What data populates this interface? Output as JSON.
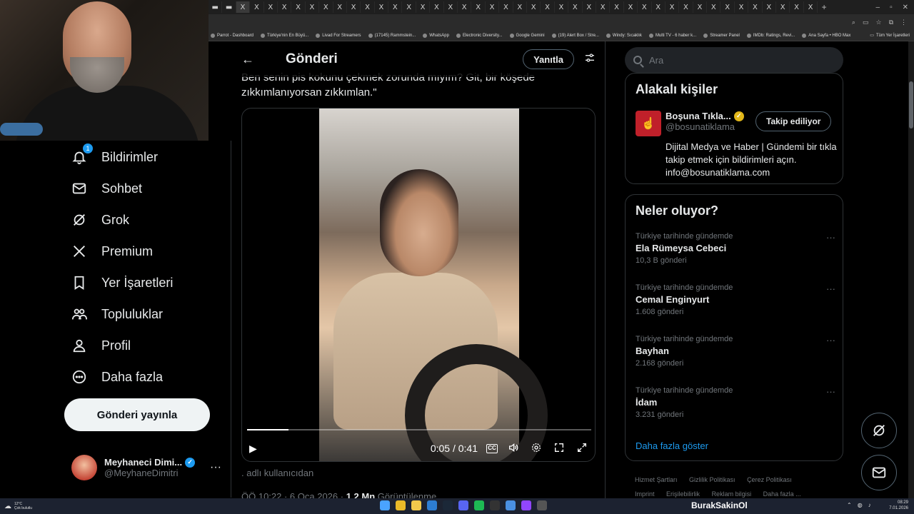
{
  "browser": {
    "tab_glyph": "X",
    "new_tab": "+",
    "window_controls": [
      "–",
      "▫",
      "✕"
    ],
    "bookmarks": [
      "Parrot - Dashboard",
      "Türkiye'nin En Büyü...",
      "Livad For Streamers",
      "(17145) Rammstein...",
      "WhatsApp",
      "Electronic Diversity...",
      "Google Gemini",
      "(19) Alert Box / Stre...",
      "Windy: Sıcaklık",
      "Multi TV - 6 haber k...",
      "Streamer Panel",
      "IMDb: Ratings, Revi...",
      "Ana Sayfa • HBO Max"
    ],
    "bookmarks_all": "Tüm Yer İşaretleri"
  },
  "nav": {
    "items": [
      {
        "label": "Bildirimler",
        "icon": "bell-icon",
        "badge": "1"
      },
      {
        "label": "Sohbet",
        "icon": "mail-icon"
      },
      {
        "label": "Grok",
        "icon": "grok-icon"
      },
      {
        "label": "Premium",
        "icon": "x-logo-icon"
      },
      {
        "label": "Yer İşaretleri",
        "icon": "bookmark-icon"
      },
      {
        "label": "Topluluklar",
        "icon": "communities-icon"
      },
      {
        "label": "Profil",
        "icon": "person-icon"
      },
      {
        "label": "Daha fazla",
        "icon": "more-circle-icon"
      }
    ],
    "post_button": "Gönderi yayınla",
    "account": {
      "name": "Meyhaneci Dimi...",
      "handle": "@MeyhaneDimitri",
      "more": "···"
    }
  },
  "main": {
    "back": "←",
    "title": "Gönderi",
    "reply_button": "Yanıtla",
    "tweet_text": "Ben senin pis kokunu çekmek zorunda mıyım? Git, bir köşede zıkkımlanıyorsan zıkkımlan.\"",
    "video": {
      "current_time": "0:05",
      "separator": "/",
      "duration": "0:41",
      "progress": 0.12,
      "cc_label": "CC"
    },
    "from_user": ". adlı kullanıcıdan",
    "meta_time": "ÖÖ 10:22 · 6 Oca 2026 ·",
    "meta_views_count": "1,2 Mn",
    "meta_views_label": "Görüntülenme"
  },
  "right": {
    "search_placeholder": "Ara",
    "related_title": "Alakalı kişiler",
    "person": {
      "name": "Boşuna Tıkla...",
      "handle": "@bosunatiklama",
      "follow_button": "Takip ediliyor",
      "bio": "Dijital Medya ve Haber | Gündemi bir tıkla takip etmek için bildirimleri açın. info@bosunatiklama.com"
    },
    "trends_title": "Neler oluyor?",
    "trends": [
      {
        "context": "Türkiye tarihinde gündemde",
        "name": "Ela Rümeysa Cebeci",
        "count": "10,3 B gönderi"
      },
      {
        "context": "Türkiye tarihinde gündemde",
        "name": "Cemal Enginyurt",
        "count": "1.608 gönderi"
      },
      {
        "context": "Türkiye tarihinde gündemde",
        "name": "Bayhan",
        "count": "2.168 gönderi"
      },
      {
        "context": "Türkiye tarihinde gündemde",
        "name": "İdam",
        "count": "3.231 gönderi"
      }
    ],
    "trend_more": "···",
    "show_more": "Daha fazla göster",
    "footer_links": [
      "Hizmet Şartları",
      "Gizlilik Politikası",
      "Çerez Politikası",
      "Imprint",
      "Erişilebilirlik",
      "Reklam bilgisi",
      "Daha fazla ..."
    ]
  },
  "taskbar": {
    "weather_temp": "12°C",
    "weather_desc": "Çok bulutlu",
    "streamer_name": "BurakSakinOl",
    "time": "08:29",
    "date": "7.01.2026"
  },
  "colors": {
    "accent": "#1d9bf0",
    "background": "#000000",
    "text": "#e7e9ea",
    "muted": "#71767b",
    "border": "#2f3336"
  }
}
